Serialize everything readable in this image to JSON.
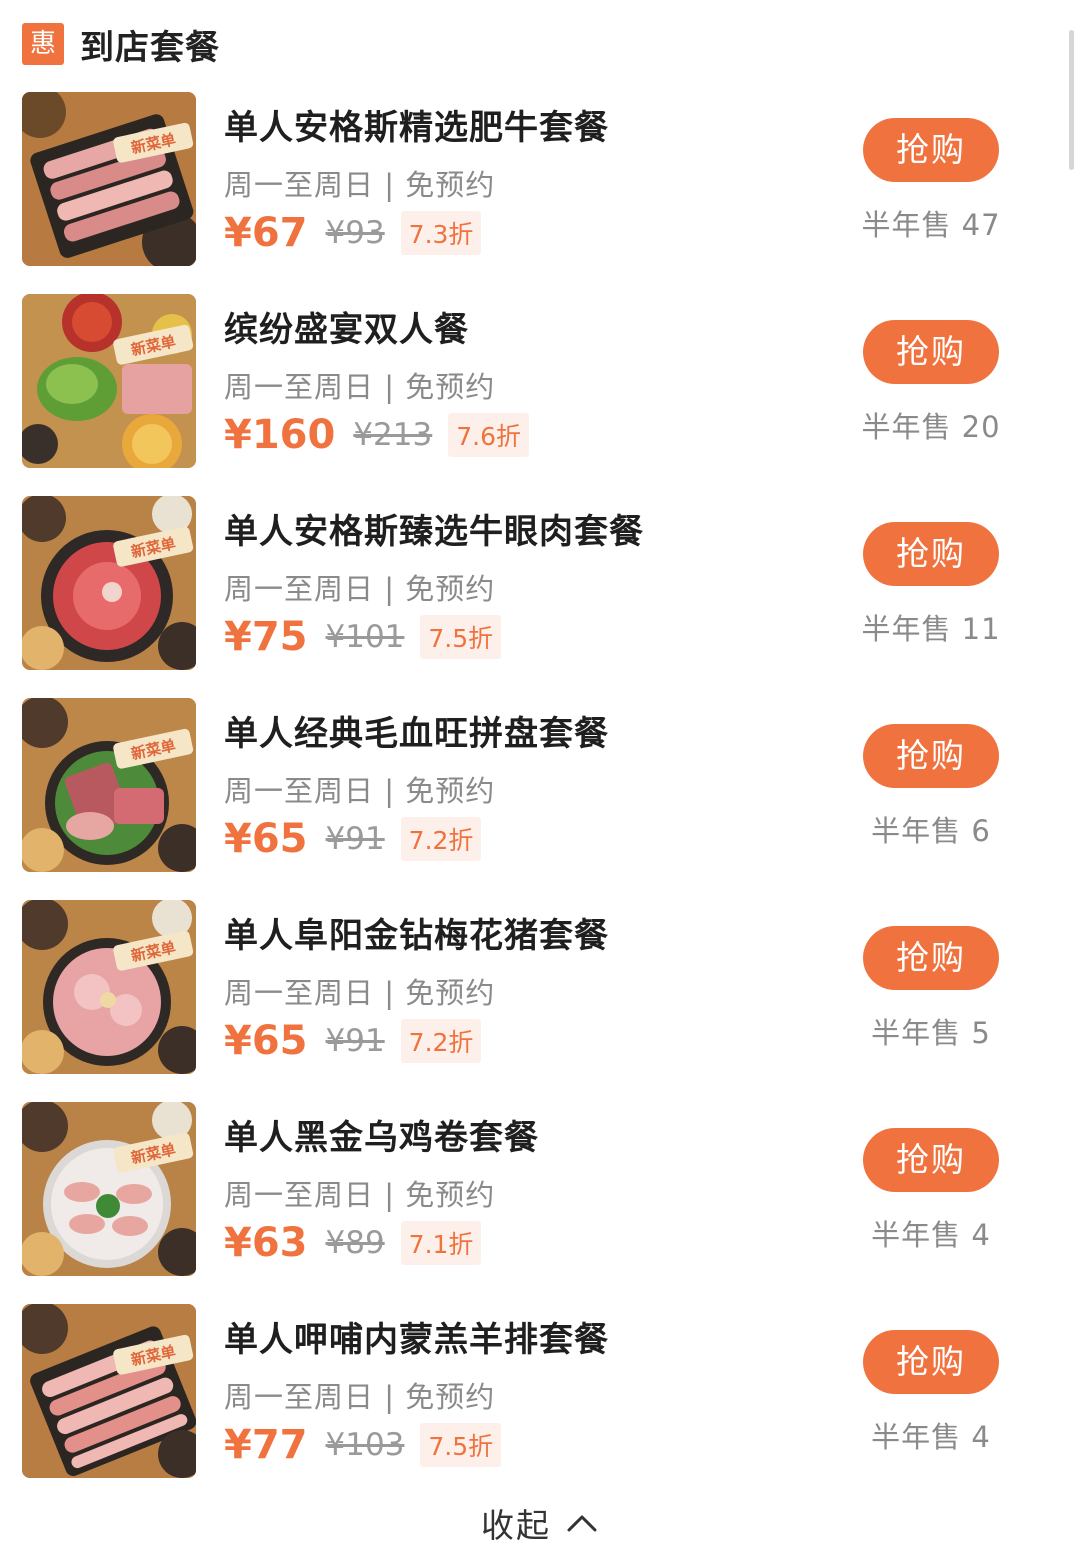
{
  "section": {
    "badge": "惠",
    "title": "到店套餐"
  },
  "deals": [
    {
      "name": "单人安格斯精选肥牛套餐",
      "usage": "周一至周日 | 免预约",
      "price": "¥67",
      "original_price": "¥93",
      "discount": "7.3折",
      "button": "抢购",
      "sold": "半年售 47",
      "thumb_label": "新菜单"
    },
    {
      "name": "缤纷盛宴双人餐",
      "usage": "周一至周日 | 免预约",
      "price": "¥160",
      "original_price": "¥213",
      "discount": "7.6折",
      "button": "抢购",
      "sold": "半年售 20",
      "thumb_label": "新菜单"
    },
    {
      "name": "单人安格斯臻选牛眼肉套餐",
      "usage": "周一至周日 | 免预约",
      "price": "¥75",
      "original_price": "¥101",
      "discount": "7.5折",
      "button": "抢购",
      "sold": "半年售 11",
      "thumb_label": "新菜单"
    },
    {
      "name": "单人经典毛血旺拼盘套餐",
      "usage": "周一至周日 | 免预约",
      "price": "¥65",
      "original_price": "¥91",
      "discount": "7.2折",
      "button": "抢购",
      "sold": "半年售 6",
      "thumb_label": "新菜单"
    },
    {
      "name": "单人阜阳金钻梅花猪套餐",
      "usage": "周一至周日 | 免预约",
      "price": "¥65",
      "original_price": "¥91",
      "discount": "7.2折",
      "button": "抢购",
      "sold": "半年售 5",
      "thumb_label": "新菜单"
    },
    {
      "name": "单人黑金乌鸡卷套餐",
      "usage": "周一至周日 | 免预约",
      "price": "¥63",
      "original_price": "¥89",
      "discount": "7.1折",
      "button": "抢购",
      "sold": "半年售 4",
      "thumb_label": "新菜单"
    },
    {
      "name": "单人呷哺内蒙羔羊排套餐",
      "usage": "周一至周日 | 免预约",
      "price": "¥77",
      "original_price": "¥103",
      "discount": "7.5折",
      "button": "抢购",
      "sold": "半年售 4",
      "thumb_label": "新菜单"
    }
  ],
  "footer": {
    "collapse_label": "收起"
  },
  "colors": {
    "accent": "#f0733f",
    "discount_bg": "#fdf0ea",
    "muted_text": "#8a8a8a"
  }
}
